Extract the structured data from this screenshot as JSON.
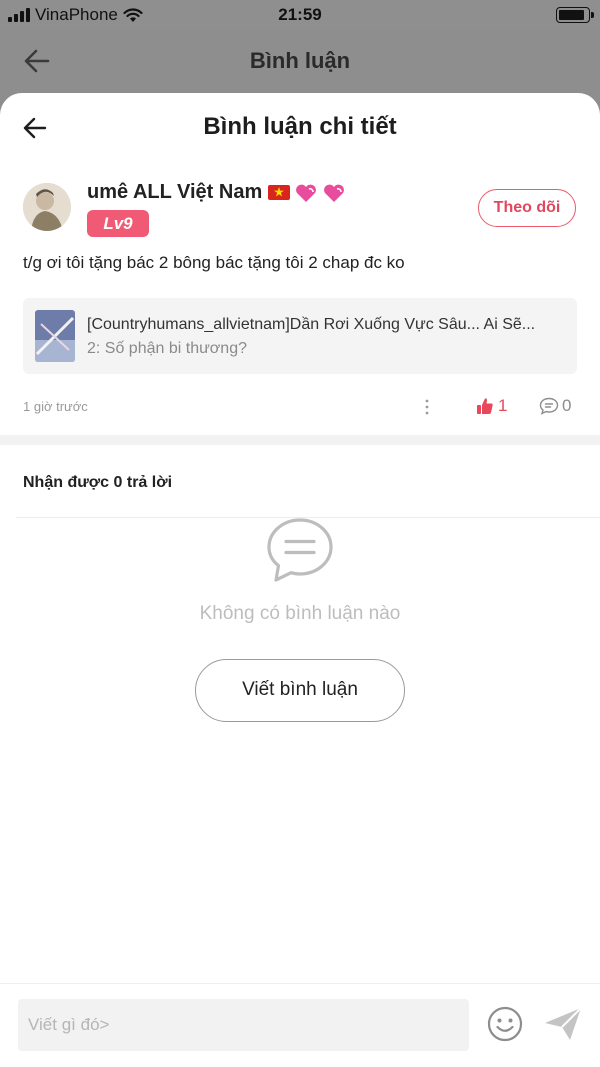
{
  "status_bar": {
    "carrier": "VinaPhone",
    "time": "21:59",
    "battery_level": 0.9
  },
  "background_page": {
    "title": "Bình luận"
  },
  "sheet": {
    "title": "Bình luận chi tiết"
  },
  "comment": {
    "username": "umê ALL Việt Nam",
    "level_badge": "Lv9",
    "follow_label": "Theo dõi",
    "text": "t/g ơi tôi tặng bác 2 bông bác tặng tôi 2 chap đc ko",
    "story": {
      "title": "[Countryhumans_allvietnam]Dần Rơi Xuống Vực Sâu... Ai Sẽ...",
      "chapter": "2: Số phận bi thương?"
    },
    "timestamp": "1 giờ trước",
    "like_count": "1",
    "reply_count": "0"
  },
  "replies": {
    "heading": "Nhận được 0 trả lời",
    "empty_text": "Không có bình luận nào",
    "write_button": "Viết bình luận"
  },
  "composer": {
    "placeholder": "Viết gì đó>"
  },
  "colors": {
    "accent": "#e8475c",
    "badge": "#f05a75",
    "overlay": "#8e8e8e"
  }
}
